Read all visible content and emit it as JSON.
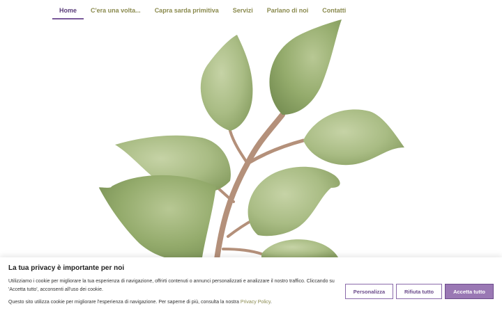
{
  "nav": {
    "items": [
      {
        "label": "Home",
        "active": true
      },
      {
        "label": "C'era una volta..."
      },
      {
        "label": "Capra sarda primitiva"
      },
      {
        "label": "Servizi"
      },
      {
        "label": "Parlano di noi"
      },
      {
        "label": "Contatti"
      }
    ]
  },
  "hero": {
    "illustration": "watercolor-branch-with-green-leaves",
    "colors": {
      "leaf": "#a9bc84",
      "leaf_dark": "#8aa064",
      "stem": "#b4907a"
    }
  },
  "cookie_banner": {
    "title": "La tua privacy è importante per noi",
    "text": "Utilizziamo i cookie per migliorare la tua esperienza di navigazione, offrirti contenuti o annunci personalizzati e analizzare il nostro traffico. Cliccando su 'Accetta tutto', acconsenti all'uso dei cookie.",
    "text2_prefix": "Questo sito utilizza cookie per migliorare l'esperienza di navigazione. Per saperne di più, consulta la nostra ",
    "privacy_link": "Privacy Policy",
    "text2_suffix": ".",
    "buttons": {
      "customize": "Personalizza",
      "reject": "Rifiuta tutto",
      "accept": "Accetta tutto"
    },
    "colors": {
      "accent": "#9a78b4",
      "border": "#8a6aaa"
    }
  }
}
